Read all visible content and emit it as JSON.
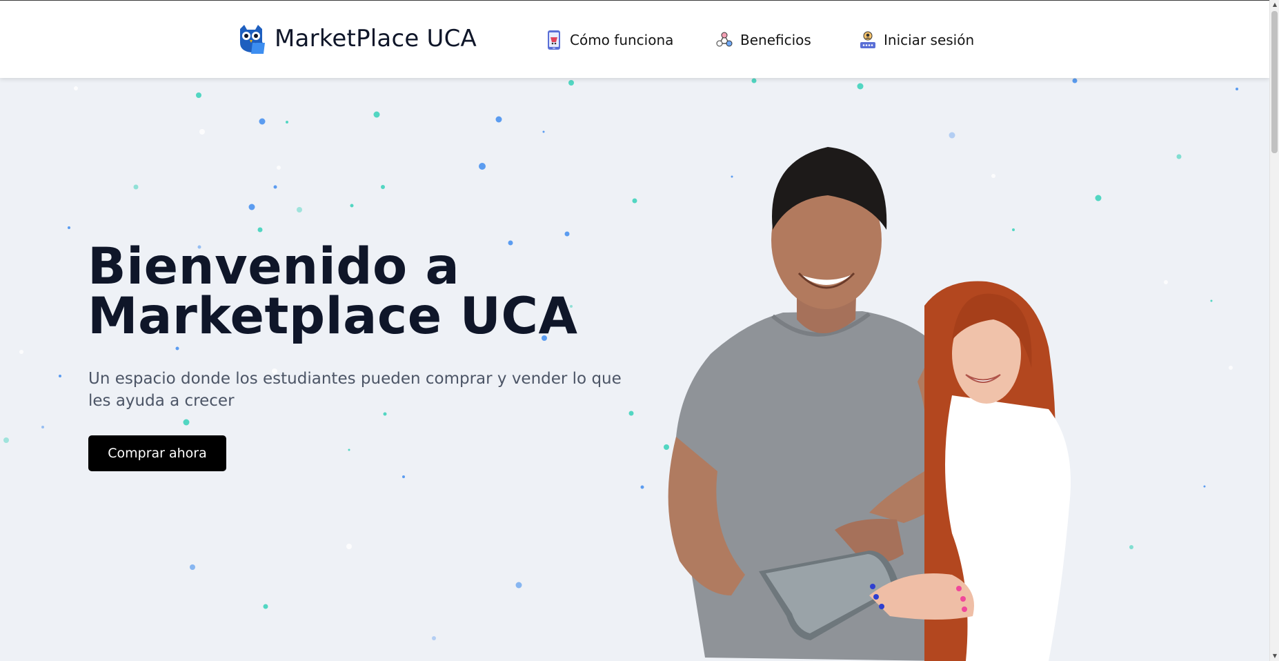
{
  "header": {
    "brand_name": "MarketPlace UCA",
    "nav": [
      {
        "label": "Cómo funciona",
        "icon": "tablet-cart-icon"
      },
      {
        "label": "Beneficios",
        "icon": "network-nodes-icon"
      },
      {
        "label": "Iniciar sesión",
        "icon": "user-password-icon"
      }
    ]
  },
  "hero": {
    "title_line1": "Bienvenido a",
    "title_line2": "Marketplace UCA",
    "subtitle": "Un espacio donde los estudiantes pueden comprar y vender lo que les ayuda a crecer",
    "cta_label": "Comprar ahora"
  },
  "colors": {
    "accent_dark": "#0f1629",
    "background": "#eef1f6",
    "dot_blue": "#5b9cf0",
    "dot_teal": "#52d6c2",
    "button": "#000000"
  }
}
